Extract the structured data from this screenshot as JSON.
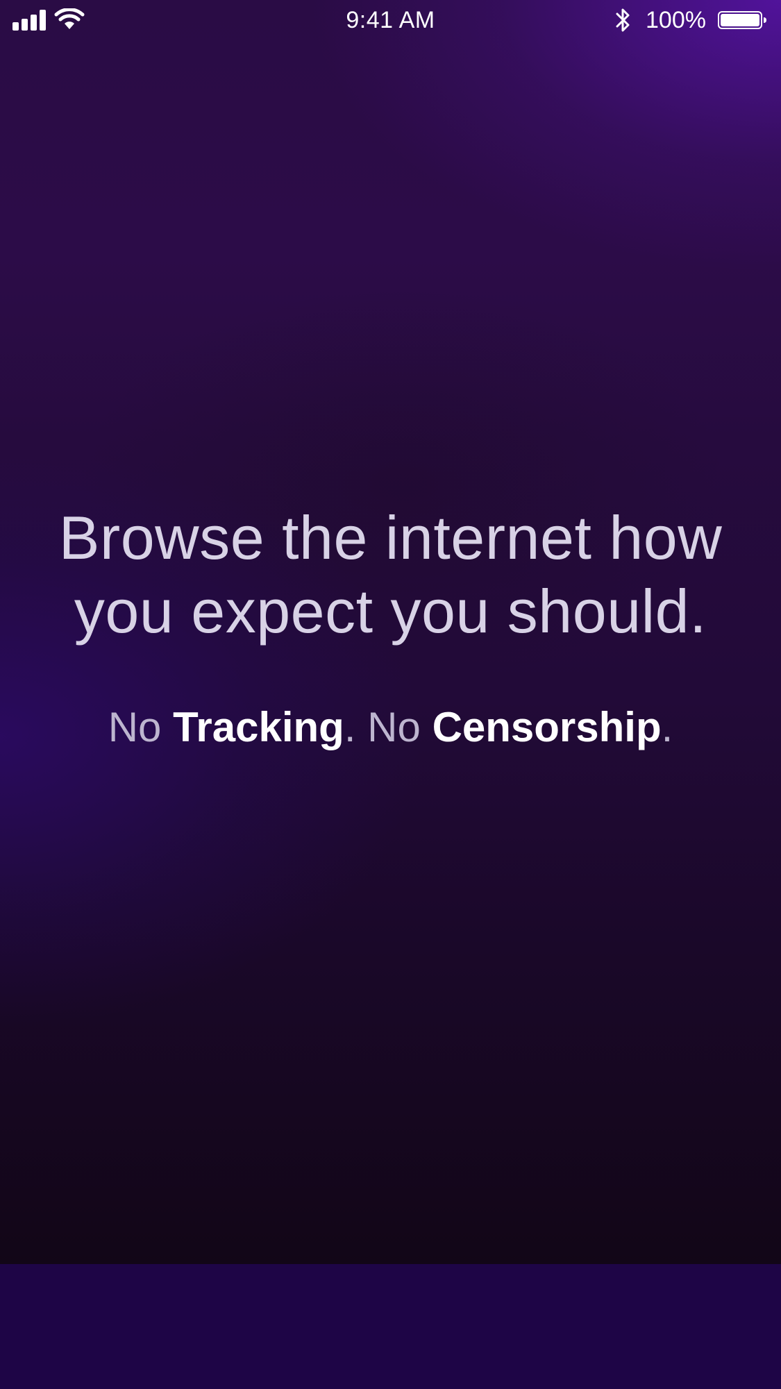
{
  "status_bar": {
    "time": "9:41 AM",
    "battery_percent": "100%",
    "signal_icon": "cellular-signal-icon",
    "wifi_icon": "wifi-icon",
    "bluetooth_icon": "bluetooth-icon",
    "battery_icon": "battery-icon",
    "battery_level": 1.0
  },
  "hero": {
    "headline_line1": "Browse the internet how",
    "headline_line2": "you expect you should.",
    "tagline": {
      "no_1": "No ",
      "feature_1": "Tracking",
      "period_1": ".",
      "no_2": " No ",
      "feature_2": "Censorship",
      "period_2": "."
    }
  },
  "colors": {
    "background_top_right": "#4a119a",
    "background_mid": "#260b3e",
    "background_bottom": "#120617",
    "footer_band": "#1e0546",
    "headline_text": "#d8d2e6",
    "tagline_strong": "#ffffff"
  }
}
